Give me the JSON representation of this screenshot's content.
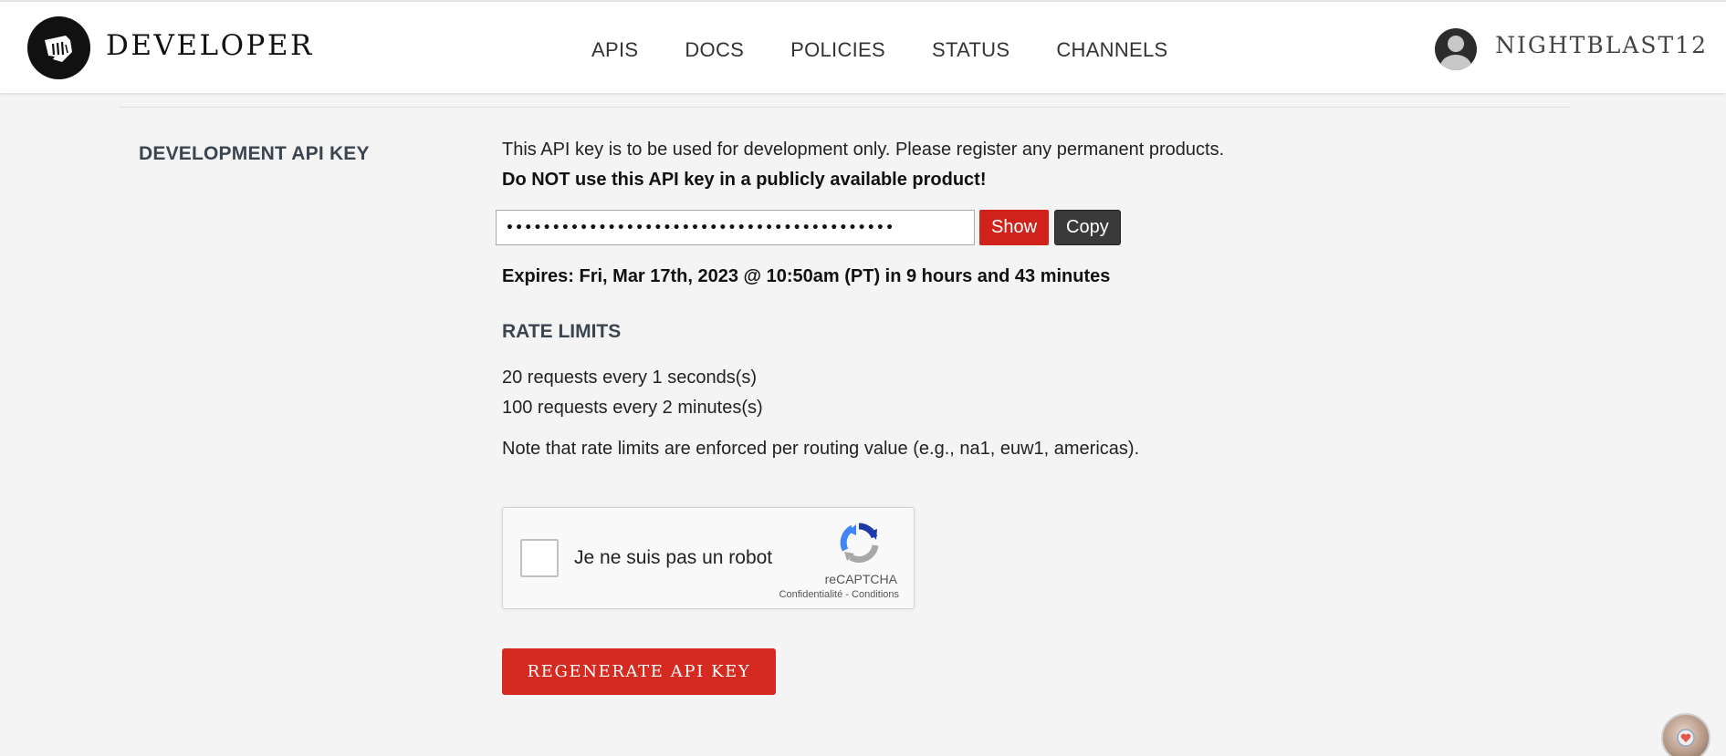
{
  "header": {
    "brand": "DEVELOPER",
    "nav": [
      "APIS",
      "DOCS",
      "POLICIES",
      "STATUS",
      "CHANNELS"
    ],
    "username": "NIGHTBLAST12"
  },
  "api_key": {
    "section_label": "DEVELOPMENT API KEY",
    "description": "This API key is to be used for development only. Please register any permanent products.",
    "warning": "Do NOT use this API key in a publicly available product!",
    "masked_value": "••••••••••••••••••••••••••••••••••••••••••",
    "show_label": "Show",
    "copy_label": "Copy",
    "expires": "Expires: Fri, Mar 17th, 2023 @ 10:50am (PT) in 9 hours and 43 minutes"
  },
  "rate_limits": {
    "heading": "RATE LIMITS",
    "limits": [
      "20 requests every 1 seconds(s)",
      "100 requests every 2 minutes(s)"
    ],
    "note": "Note that rate limits are enforced per routing value (e.g., na1, euw1, americas)."
  },
  "captcha": {
    "label": "Je ne suis pas un robot",
    "brand": "reCAPTCHA",
    "privacy": "Confidentialité",
    "separator": " - ",
    "terms": "Conditions"
  },
  "regenerate_label": "REGENERATE API KEY",
  "colors": {
    "accent_red": "#d0221b",
    "dark_button": "#3a3a3a",
    "background": "#f4f4f4",
    "heading": "#3a4550"
  }
}
